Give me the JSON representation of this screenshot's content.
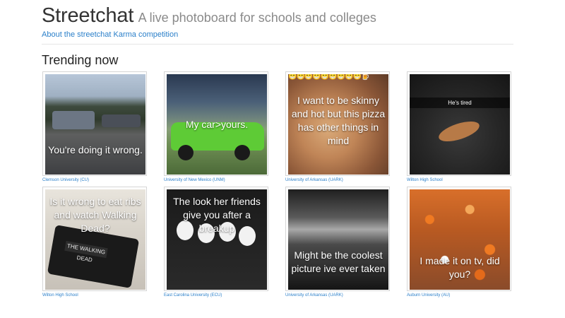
{
  "header": {
    "brand": "Streetchat",
    "tagline": "A live photoboard for schools and colleges",
    "about_link": "About the streetchat Karma competition"
  },
  "section": {
    "title": "Trending now"
  },
  "cards": [
    {
      "caption": "You're doing it wrong.",
      "school": "Clemson University (CU)",
      "style": "big",
      "theme": "parking-lot"
    },
    {
      "caption": "My car>yours.",
      "school": "University of New Mexico (UNM)",
      "style": "big",
      "theme": "green-car"
    },
    {
      "caption": "I want to be skinny and hot but this pizza has other things in mind",
      "school": "University of Arkansas (UARK)",
      "style": "big",
      "theme": "pizza"
    },
    {
      "caption": "He's tired",
      "school": "Wilton High School",
      "style": "bar",
      "theme": "chipmunk"
    },
    {
      "caption": "Is it wrong to eat ribs and watch Walking Dead?",
      "school": "Wilton High School",
      "style": "big",
      "theme": "tablet"
    },
    {
      "caption": "The look her friends give you after a breakup",
      "school": "East Carolina University (ECU)",
      "style": "big",
      "theme": "skull-faces"
    },
    {
      "caption": "Might be the coolest picture ive ever taken",
      "school": "University of Arkansas (UARK)",
      "style": "big",
      "theme": "sky"
    },
    {
      "caption": "I made it on tv, did you?",
      "school": "Auburn University (AU)",
      "style": "big",
      "theme": "crowd"
    }
  ],
  "emoji_strip": "😁😁😁😁😁😁😁😁😁🍺",
  "colors": {
    "link": "#2a7fc9",
    "brand_text": "#333333",
    "tagline_text": "#8a8a8a"
  }
}
